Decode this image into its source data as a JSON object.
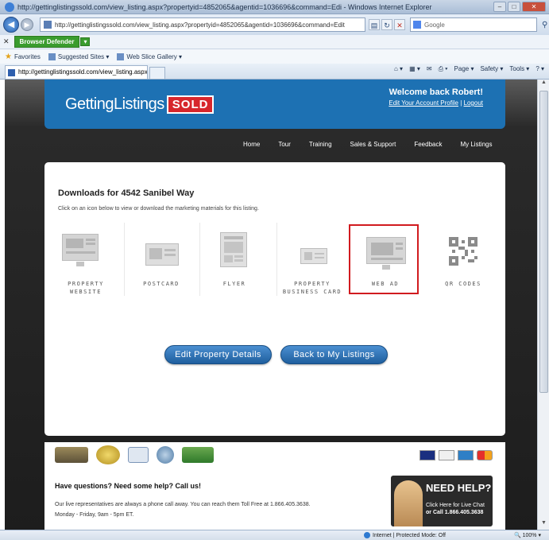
{
  "browser": {
    "title": "http://gettinglistingssold.com/view_listing.aspx?propertyid=4852065&agentid=1036696&command=Edi - Windows Internet Explorer",
    "url_host": "http://gettinglistingssold.com",
    "url_path": "/view_listing.aspx?propertyid=4852065&agentid=1036696&command=Edit",
    "search_provider": "Google",
    "defender_label": "Browser Defender",
    "favorites_label": "Favorites",
    "suggested_sites": "Suggested Sites ▾",
    "web_slice": "Web Slice Gallery ▾",
    "tab_title": "http://gettinglistingssold.com/view_listing.aspx?...",
    "commands": [
      "Page ▾",
      "Safety ▾",
      "Tools ▾"
    ],
    "status_zone": "Internet | Protected Mode: Off",
    "zoom": "100%"
  },
  "site": {
    "logo_text": "GettingListings",
    "logo_badge": "SOLD",
    "welcome": "Welcome back Robert!",
    "edit_account": "Edit Your Account Profile",
    "logout": "Logout",
    "nav": [
      "Home",
      "Tour",
      "Training",
      "Sales & Support",
      "Feedback",
      "My Listings"
    ]
  },
  "downloads": {
    "heading": "Downloads for 4542 Sanibel Way",
    "instruction": "Click on an icon below to view or download the marketing materials for this listing.",
    "tiles": [
      {
        "line1": "PROPERTY",
        "line2": "WEBSITE"
      },
      {
        "line1": "POSTCARD",
        "line2": ""
      },
      {
        "line1": "FLYER",
        "line2": ""
      },
      {
        "line1": "PROPERTY",
        "line2": "BUSINESS CARD"
      },
      {
        "line1": "WEB AD",
        "line2": ""
      },
      {
        "line1": "QR CODES",
        "line2": ""
      }
    ],
    "selected_tile": "WEB AD",
    "edit_button": "Edit Property Details",
    "back_button": "Back to My Listings"
  },
  "footer": {
    "question": "Have questions? Need some help? Call us!",
    "text": "Our live representatives are always a phone call away. You can reach them Toll Free at 1.866.405.3638. Monday - Friday, 9am - 5pm ET.",
    "need_help": "NEED HELP?",
    "live_chat": "Click Here for Live Chat",
    "call": "or Call 1.866.405.3638"
  },
  "colors": {
    "brand_blue": "#1d71b3",
    "sold_red": "#d7262c",
    "selection_red": "#d11b1f",
    "button_blue": "#2f76ba"
  }
}
